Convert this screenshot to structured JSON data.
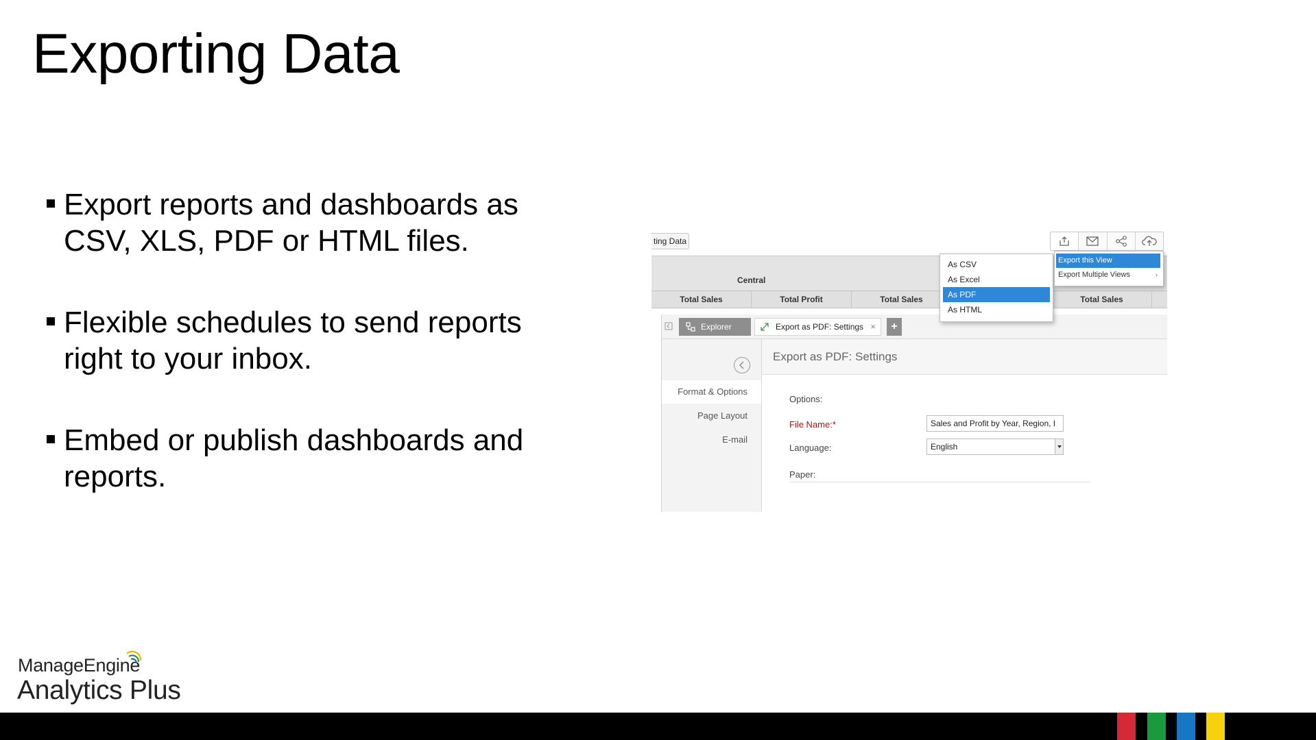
{
  "slide": {
    "title": "Exporting Data",
    "bullets": [
      "Export reports and dashboards as CSV, XLS, PDF or HTML files.",
      "Flexible schedules to send reports right to your inbox.",
      "Embed or publish dashboards and reports."
    ]
  },
  "screenshot": {
    "tab_chip": "ting Data",
    "toolbar": {
      "icons": [
        "export-icon",
        "email-icon",
        "share-icon",
        "publish-icon"
      ]
    },
    "grid": {
      "region": "Central",
      "headers": [
        "Total Sales",
        "Total Profit",
        "Total Sales",
        "",
        "Total Sales"
      ]
    },
    "export_menu": [
      "As CSV",
      "As Excel",
      "As PDF",
      "As HTML"
    ],
    "export_menu_selected": "As PDF",
    "view_menu": [
      "Export this View",
      "Export Multiple Views"
    ],
    "view_menu_selected": "Export this View",
    "tabs": {
      "explorer": "Explorer",
      "settings": "Export as PDF: Settings",
      "close": "×",
      "add": "+"
    },
    "sidebar": [
      "Format & Options",
      "Page Layout",
      "E-mail"
    ],
    "content": {
      "title": "Export as PDF: Settings",
      "options_label": "Options:",
      "file_name_label": "File Name:*",
      "file_name_value": "Sales and Profit by Year, Region, I",
      "language_label": "Language:",
      "language_value": "English",
      "paper_label": "Paper:"
    },
    "colors": {
      "selection": "#2f87d7"
    }
  },
  "brand": {
    "company": "ManageEngine",
    "product": "Analytics Plus",
    "stripe_colors": [
      "#d42a35",
      "#1a9a3c",
      "#1777c2",
      "#f5d20a"
    ]
  }
}
